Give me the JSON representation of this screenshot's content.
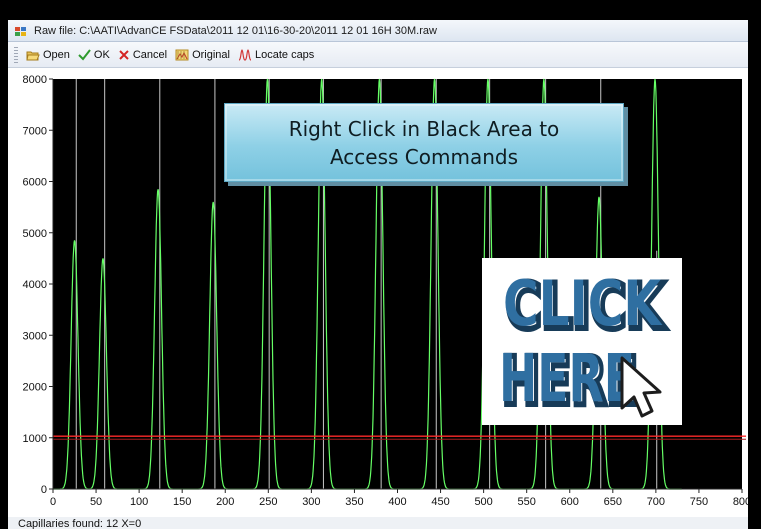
{
  "window": {
    "title": "Raw file: C:\\AATI\\AdvanCE FSData\\2011 12 01\\16-30-20\\2011 12 01 16H 30M.raw"
  },
  "toolbar": {
    "items": [
      {
        "label": "Open",
        "icon": "folder-open-icon"
      },
      {
        "label": "OK",
        "icon": "checkmark-icon"
      },
      {
        "label": "Cancel",
        "icon": "cancel-x-icon"
      },
      {
        "label": "Original",
        "icon": "original-icon"
      },
      {
        "label": "Locate caps",
        "icon": "locate-caps-icon"
      }
    ]
  },
  "callout": {
    "line1": "Right Click in Black Area to",
    "line2": "Access Commands"
  },
  "clickhere": {
    "line1": "CLICK",
    "line2": "HERE",
    "text_color": "#2f6fa1",
    "shadow_color": "#173b58"
  },
  "status": {
    "text": "Capillaries found: 12   X=0"
  },
  "chart_data": {
    "type": "line",
    "xlim": [
      0,
      800
    ],
    "ylim": [
      0,
      8000
    ],
    "x_ticks": [
      0,
      50,
      100,
      150,
      200,
      250,
      300,
      350,
      400,
      450,
      500,
      550,
      600,
      650,
      700,
      750,
      800
    ],
    "y_ticks": [
      0,
      1000,
      2000,
      3000,
      4000,
      5000,
      6000,
      7000,
      8000
    ],
    "background": "#000000",
    "series_color": "#66ff66",
    "capillary_line_color": "#c8c8c8",
    "threshold_color": "#ff2a2a",
    "threshold": 1030,
    "peaks": [
      {
        "x": 25,
        "height": 4850,
        "width": 4
      },
      {
        "x": 58,
        "height": 4500,
        "width": 4
      },
      {
        "x": 122,
        "height": 5850,
        "width": 4
      },
      {
        "x": 186,
        "height": 5600,
        "width": 4
      },
      {
        "x": 249,
        "height": 8000,
        "width": 4
      },
      {
        "x": 312,
        "height": 8000,
        "width": 4
      },
      {
        "x": 379,
        "height": 8000,
        "width": 4
      },
      {
        "x": 443,
        "height": 8000,
        "width": 4
      },
      {
        "x": 505,
        "height": 8000,
        "width": 4
      },
      {
        "x": 570,
        "height": 8000,
        "width": 4
      },
      {
        "x": 634,
        "height": 5700,
        "width": 4
      },
      {
        "x": 699,
        "height": 8000,
        "width": 4
      }
    ],
    "capillary_markers": [
      {
        "x": 27,
        "top": 8000
      },
      {
        "x": 60,
        "top": 8000
      },
      {
        "x": 124,
        "top": 8000
      },
      {
        "x": 188,
        "top": 8000
      },
      {
        "x": 251,
        "top": 8000
      },
      {
        "x": 314,
        "top": 8000
      },
      {
        "x": 381,
        "top": 8000
      },
      {
        "x": 445,
        "top": 8000
      },
      {
        "x": 507,
        "top": 8000
      },
      {
        "x": 572,
        "top": 8000
      },
      {
        "x": 636,
        "top": 8000
      },
      {
        "x": 701,
        "top": 4650
      }
    ]
  }
}
